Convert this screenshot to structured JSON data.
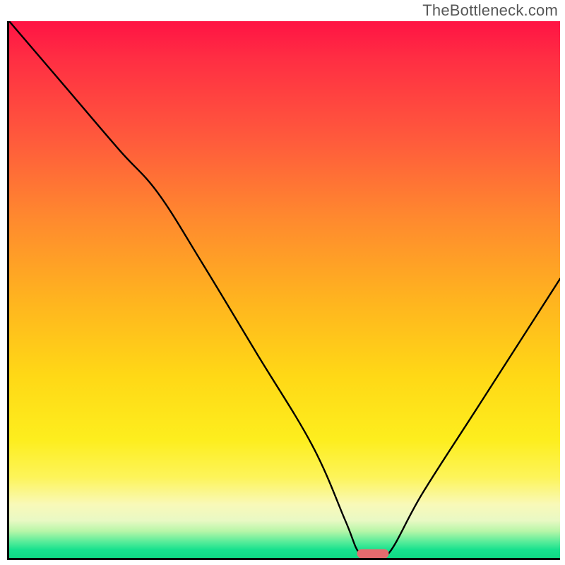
{
  "watermark": "TheBottleneck.com",
  "chart_data": {
    "type": "line",
    "title": "",
    "xlabel": "",
    "ylabel": "",
    "xlim": [
      0,
      100
    ],
    "ylim": [
      0,
      100
    ],
    "grid": false,
    "gradient": {
      "orientation": "vertical",
      "top_color": "#ff1344",
      "bottom_color": "#0fd884",
      "description": "spectral red-to-green vertical gradient (red top, green bottom)"
    },
    "series": [
      {
        "name": "curve",
        "x": [
          0,
          10,
          20,
          27,
          35,
          45,
          55,
          61,
          63.5,
          66,
          69,
          75,
          85,
          95,
          100
        ],
        "y": [
          100,
          88,
          76,
          68,
          55,
          38,
          21,
          7,
          1,
          0.5,
          1,
          12,
          28,
          44,
          52
        ]
      }
    ],
    "marker": {
      "shape": "pill",
      "color": "#e46b6f",
      "x": 66,
      "y": 0.8
    }
  }
}
